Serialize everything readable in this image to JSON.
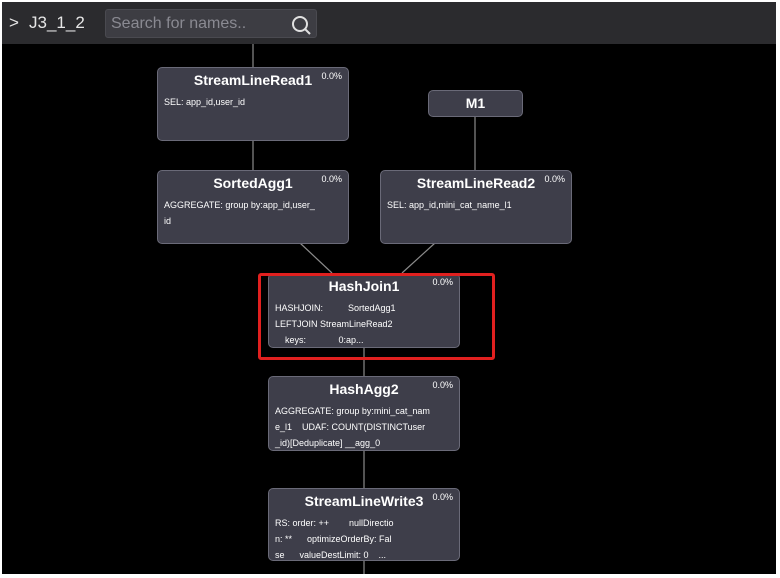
{
  "header": {
    "arrow": ">",
    "breadcrumb": "J3_1_2",
    "search_placeholder": "Search for names.."
  },
  "nodes": {
    "streamlineread1": {
      "title": "StreamLineRead1",
      "pct": "0.0%",
      "body": "SEL: app_id,user_id"
    },
    "m1": {
      "title": "M1"
    },
    "sortedagg1": {
      "title": "SortedAgg1",
      "pct": "0.0%",
      "body": "AGGREGATE: group by:app_id,user_\nid"
    },
    "streamlineread2": {
      "title": "StreamLineRead2",
      "pct": "0.0%",
      "body": "SEL: app_id,mini_cat_name_l1"
    },
    "hashjoin1": {
      "title": "HashJoin1",
      "pct": "0.0%",
      "body": "HASHJOIN:          SortedAgg1\nLEFTJOIN StreamLineRead2\n    keys:             0:ap..."
    },
    "hashagg2": {
      "title": "HashAgg2",
      "pct": "0.0%",
      "body": "AGGREGATE: group by:mini_cat_nam\ne_l1    UDAF: COUNT(DISTINCTuser\n_id)[Deduplicate] __agg_0"
    },
    "streamlinewrite3": {
      "title": "StreamLineWrite3",
      "pct": "0.0%",
      "body": "RS: order: ++        nullDirectio\nn: **      optimizeOrderBy: Fal\nse      valueDestLimit: 0    ..."
    }
  },
  "colors": {
    "canvas": "#000000",
    "node_fill": "#3e3e4a",
    "edge": "#8a8a8a",
    "highlight": "#e1201f"
  }
}
